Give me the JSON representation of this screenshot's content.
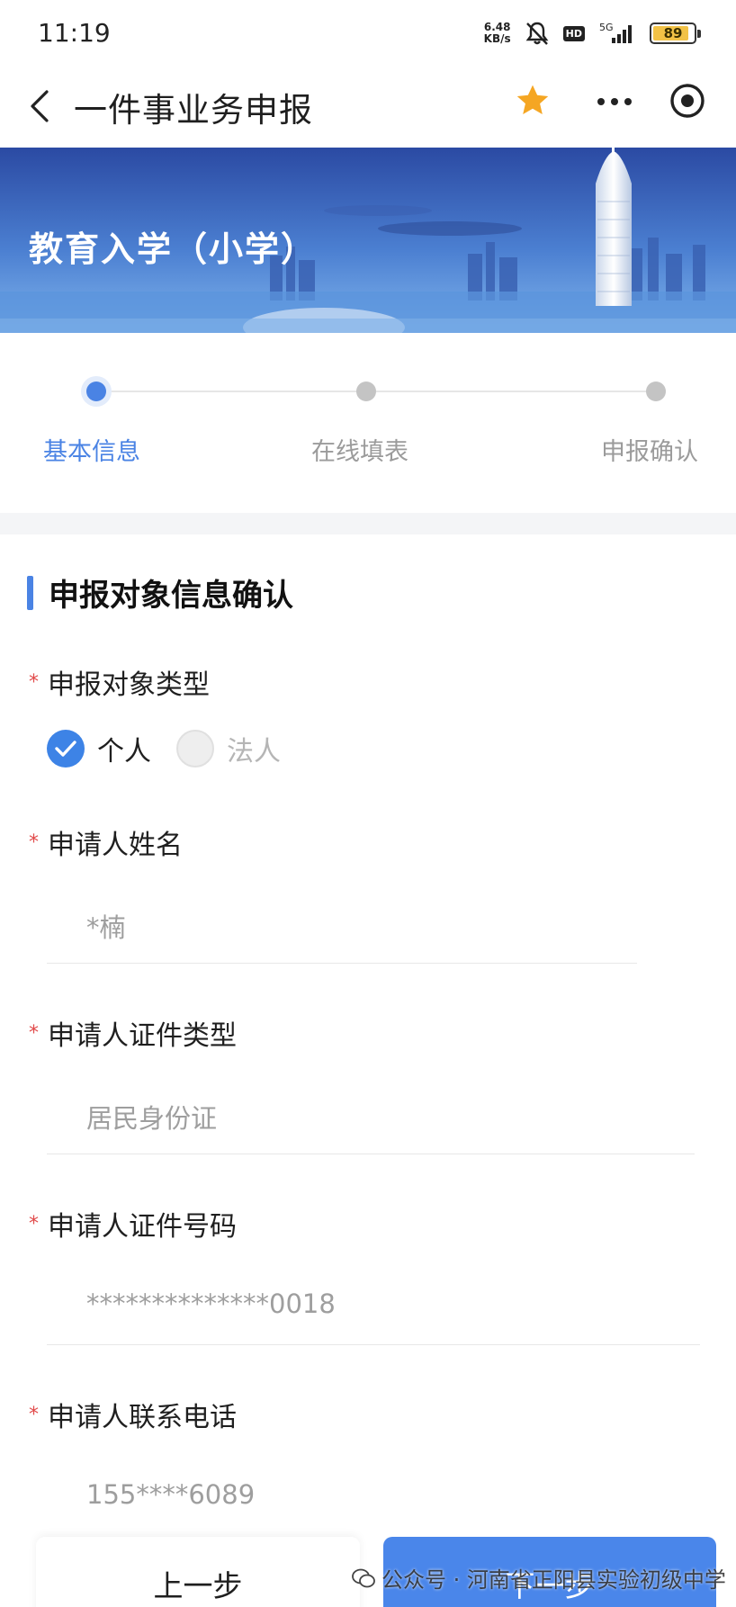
{
  "status_bar": {
    "time": "11:19",
    "net_speed_value": "6.48",
    "net_speed_unit": "KB/s",
    "hd": "HD",
    "network": "5G",
    "battery_level": "89",
    "battery_fraction": 0.89
  },
  "nav": {
    "title": "一件事业务申报",
    "icons": [
      "back-icon",
      "star-icon",
      "more-icon",
      "target-icon"
    ],
    "star_color": "#f5a623"
  },
  "banner": {
    "title": "教育入学（小学）"
  },
  "steps": [
    {
      "label": "基本信息",
      "active": true
    },
    {
      "label": "在线填表",
      "active": false
    },
    {
      "label": "申报确认",
      "active": false
    }
  ],
  "form": {
    "section_title": "申报对象信息确认",
    "required_mark": "*",
    "object_type": {
      "label": "申报对象类型",
      "options": [
        {
          "label": "个人",
          "checked": true
        },
        {
          "label": "法人",
          "checked": false
        }
      ]
    },
    "name": {
      "label": "申请人姓名",
      "value": "*楠"
    },
    "id_type": {
      "label": "申请人证件类型",
      "value": "居民身份证"
    },
    "id_number": {
      "label": "申请人证件号码",
      "value": "**************0018"
    },
    "phone": {
      "label": "申请人联系电话",
      "value": "155****6089"
    }
  },
  "bottom": {
    "prev_label": "上一步",
    "next_label": "下一步"
  },
  "watermark": {
    "text": "公众号 · 河南省正阳县实验初级中学"
  },
  "colors": {
    "accent": "#4a83e4",
    "required": "#e14a4a",
    "battery": "#f2c246"
  }
}
